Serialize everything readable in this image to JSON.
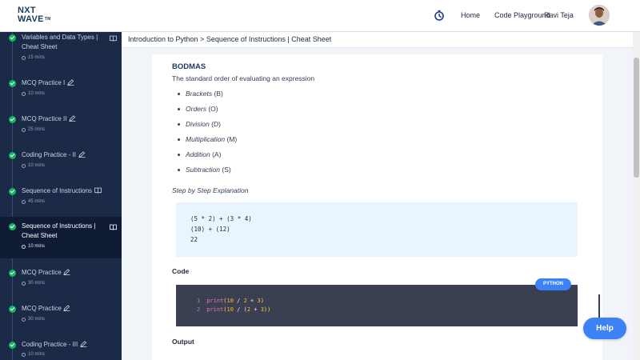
{
  "header": {
    "logo_line1": "NXT",
    "logo_line2": "WAVE",
    "logo_tm": "TM",
    "nav_home": "Home",
    "nav_code_playground": "Code Playground",
    "user_name": "Ravi Teja"
  },
  "sidebar": {
    "items": [
      {
        "title_line1": "Variables and Data Types |",
        "title_line2": "Cheat Sheet",
        "time": "15 mins",
        "icon": "book-icon"
      },
      {
        "title_line1": "MCQ Practice I",
        "time": "10 mins",
        "icon": "pencil-icon"
      },
      {
        "title_line1": "MCQ Practice II",
        "time": "25 mins",
        "icon": "pencil-icon"
      },
      {
        "title_line1": "Coding Practice - II",
        "time": "10 mins",
        "icon": "pencil-icon"
      },
      {
        "title_line1": "Sequence of Instructions",
        "time": "45 mins",
        "icon": "book-icon"
      },
      {
        "title_line1": "Sequence of Instructions |",
        "title_line2": "Cheat Sheet",
        "time": "10 mins",
        "icon": "book-icon",
        "active": true
      },
      {
        "title_line1": "MCQ Practice",
        "time": "30 mins",
        "icon": "pencil-icon"
      },
      {
        "title_line1": "MCQ Practice",
        "time": "30 mins",
        "icon": "pencil-icon"
      },
      {
        "title_line1": "Coding Practice - III",
        "time": "10 mins",
        "icon": "pencil-icon"
      }
    ]
  },
  "main": {
    "breadcrumb": "Introduction to Python > Sequence of Instructions | Cheat Sheet",
    "heading": "BODMAS",
    "description": "The standard order of evaluating an expression",
    "bullets": [
      {
        "term": "Brackets",
        "abbr": " (B)"
      },
      {
        "term": "Orders",
        "abbr": " (O)"
      },
      {
        "term": "Division",
        "abbr": " (D)"
      },
      {
        "term": "Multiplication",
        "abbr": " (M)"
      },
      {
        "term": "Addition",
        "abbr": " (A)"
      },
      {
        "term": "Subtraction",
        "abbr": " (S)"
      }
    ],
    "step_heading": "Step by Step Explanation",
    "step_lines": [
      "(5 * 2) + (3 * 4)",
      "(10) + (12)",
      "22"
    ],
    "code_heading": "Code",
    "code_language": "PYTHON",
    "code_lines": [
      {
        "num": "1",
        "fn": "print",
        "open": "(",
        "a": "10",
        "op1": " / ",
        "b": "2",
        "op2": " + ",
        "c": "3",
        "close": ")"
      },
      {
        "num": "2",
        "fn": "print",
        "open": "(",
        "a": "10",
        "op1": " / (",
        "b": "2",
        "op2": " + ",
        "c": "3",
        "close": "))"
      }
    ],
    "output_heading": "Output"
  },
  "help_label": "Help",
  "colors": {
    "sidebar_bg": "#1b2a47",
    "sidebar_active": "#0f1c34",
    "check_green": "#16b364",
    "accent_blue": "#3b82f6",
    "code_bg": "#3a3f52",
    "step_bg": "#eaf4fc"
  }
}
